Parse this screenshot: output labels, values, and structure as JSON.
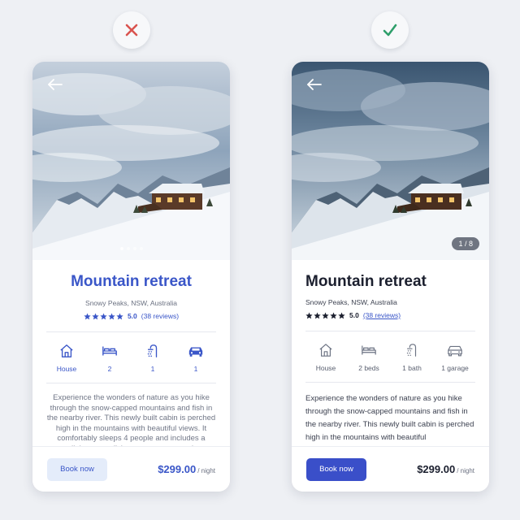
{
  "colors": {
    "accent": "#3a56c8",
    "primary_button": "#3a4fc9",
    "bad": "#d9534f",
    "good": "#2e9e6a"
  },
  "badges": {
    "bad": {
      "icon": "x-mark-icon"
    },
    "good": {
      "icon": "check-mark-icon"
    }
  },
  "left_card": {
    "title": "Mountain retreat",
    "location": "Snowy Peaks, NSW, Australia",
    "rating": "5.0",
    "reviews": "(38 reviews)",
    "amenities": [
      {
        "icon": "house-icon",
        "label": "House"
      },
      {
        "icon": "bed-icon",
        "label": "2"
      },
      {
        "icon": "shower-icon",
        "label": "1"
      },
      {
        "icon": "car-icon",
        "label": "1"
      }
    ],
    "description": "Experience the wonders of nature as you hike through the snow-capped mountains and fish in the nearby river. This newly built cabin is perched high in the mountains with beautiful views. It comfortably sleeps 4 people and includes a dining room, living room, sauna, and",
    "book_label": "Book now",
    "price": "$299.00",
    "price_unit": "/ night"
  },
  "right_card": {
    "title": "Mountain retreat",
    "location": "Snowy Peaks, NSW, Australia",
    "rating": "5.0",
    "reviews": "(38 reviews)",
    "photo_counter": "1 / 8",
    "amenities": [
      {
        "icon": "house-icon",
        "label": "House"
      },
      {
        "icon": "bed-icon",
        "label": "2 beds"
      },
      {
        "icon": "shower-icon",
        "label": "1 bath"
      },
      {
        "icon": "car-icon",
        "label": "1 garage"
      }
    ],
    "description": "Experience the wonders of nature as you hike through the snow-capped mountains and fish in the nearby river. This newly built cabin is perched high in the mountains with beautiful",
    "book_label": "Book now",
    "price": "$299.00",
    "price_unit": "/ night"
  }
}
